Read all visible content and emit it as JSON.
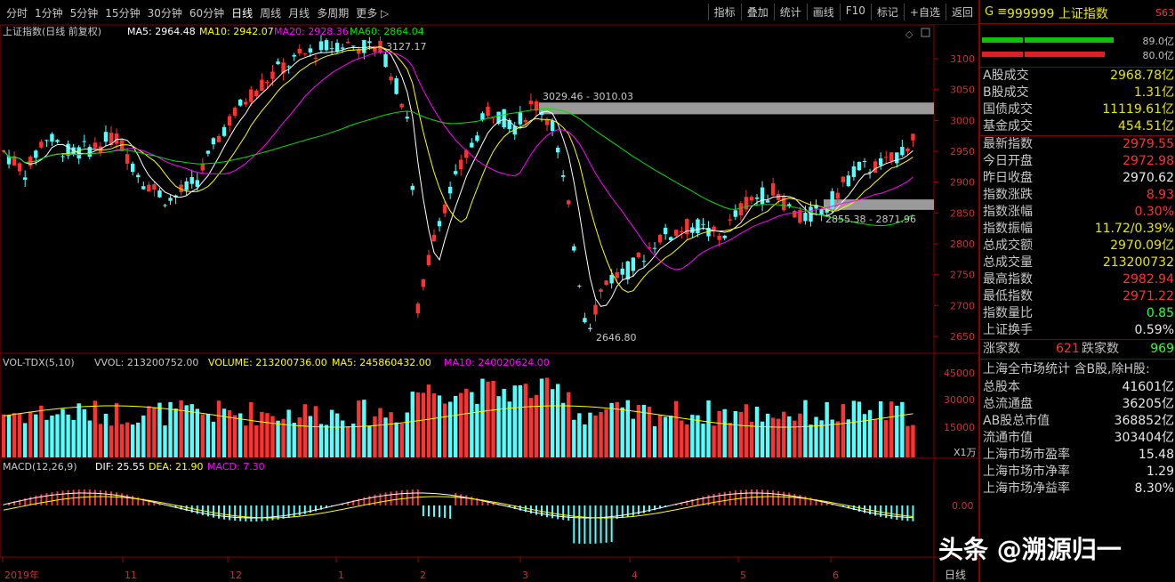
{
  "toolbar": {
    "periods": [
      "分时",
      "1分钟",
      "5分钟",
      "15分钟",
      "30分钟",
      "60分钟",
      "日线",
      "周线",
      "月线",
      "多周期",
      "更多 ▷"
    ],
    "active": "日线",
    "buttons": [
      "指标",
      "叠加",
      "统计",
      "画线",
      "F10",
      "标记",
      "+自选",
      "返回"
    ]
  },
  "main": {
    "title": "上证指数(日线 前复权)",
    "ma5": "MA5: 2964.48",
    "ma10": "MA10: 2942.07",
    "ma20": "MA20: 2928.36",
    "ma60": "MA60: 2864.04",
    "ticks": [
      "3100",
      "3050",
      "3000",
      "2950",
      "2900",
      "2850",
      "2800",
      "2750",
      "2700",
      "2650"
    ],
    "ann_high": "3127.17",
    "ann_zone1": "3029.46 - 3010.03",
    "ann_zone2": "2855.38 - 2871.96",
    "ann_low": "2646.80"
  },
  "vol": {
    "title": "VOL-TDX(5,10)",
    "vvol": "VVOL: 213200752.00",
    "volume": "VOLUME: 213200736.00",
    "ma5": "MA5: 245860432.00",
    "ma10": "MA10: 240020624.00",
    "ticks": [
      "45000",
      "30000",
      "15000"
    ],
    "unit": "X1万"
  },
  "macd": {
    "title": "MACD(12,26,9)",
    "dif": "DIF: 25.55",
    "dea": "DEA: 21.90",
    "macd": "MACD: 7.30",
    "tick": "0.00"
  },
  "xaxis": {
    "labels": [
      "2019年",
      "11",
      "12",
      "1",
      "2",
      "3",
      "4",
      "5",
      "6"
    ],
    "period": "日线"
  },
  "panel": {
    "code": "999999 上证指数",
    "g": "G ≡",
    "badge": "S63",
    "bar1": "89.0亿",
    "bar2": "80.0亿",
    "rows1": [
      {
        "k": "A股成交",
        "v": "2968.78亿",
        "c": "y"
      },
      {
        "k": "B股成交",
        "v": "1.31亿",
        "c": "y"
      },
      {
        "k": "国债成交",
        "v": "11119.61亿",
        "c": "y"
      },
      {
        "k": "基金成交",
        "v": "454.51亿",
        "c": "y"
      }
    ],
    "rows2": [
      {
        "k": "最新指数",
        "v": "2979.55",
        "c": "r"
      },
      {
        "k": "今日开盘",
        "v": "2972.98",
        "c": "r"
      },
      {
        "k": "昨日收盘",
        "v": "2970.62",
        "c": "w"
      },
      {
        "k": "指数涨跌",
        "v": "8.93",
        "c": "r"
      },
      {
        "k": "指数涨幅",
        "v": "0.30%",
        "c": "r"
      },
      {
        "k": "指数振幅",
        "v": "11.72/0.39%",
        "c": "y"
      },
      {
        "k": "总成交额",
        "v": "2970.09亿",
        "c": "y"
      },
      {
        "k": "总成交量",
        "v": "213200732",
        "c": "y"
      },
      {
        "k": "最高指数",
        "v": "2982.94",
        "c": "r"
      },
      {
        "k": "最低指数",
        "v": "2971.22",
        "c": "r"
      },
      {
        "k": "指数量比",
        "v": "0.85",
        "c": "gr"
      },
      {
        "k": "上证换手",
        "v": "0.59%",
        "c": "w"
      }
    ],
    "up_label": "涨家数",
    "up": "621",
    "down_label": "跌家数",
    "down": "969",
    "stat_title": "上海全市场统计 含B股,除H股:",
    "rows3": [
      {
        "k": "总股本",
        "v": "41601亿"
      },
      {
        "k": "总流通盘",
        "v": "36205亿"
      },
      {
        "k": "AB股总市值",
        "v": "368852亿"
      },
      {
        "k": "流通市值",
        "v": "303404亿"
      },
      {
        "k": "上海市场市盈率",
        "v": "15.48"
      },
      {
        "k": "上海市场市净率",
        "v": "1.29"
      },
      {
        "k": "上海市场净益率",
        "v": "8.30%"
      }
    ]
  },
  "watermark": "头条 @溯源归一"
}
